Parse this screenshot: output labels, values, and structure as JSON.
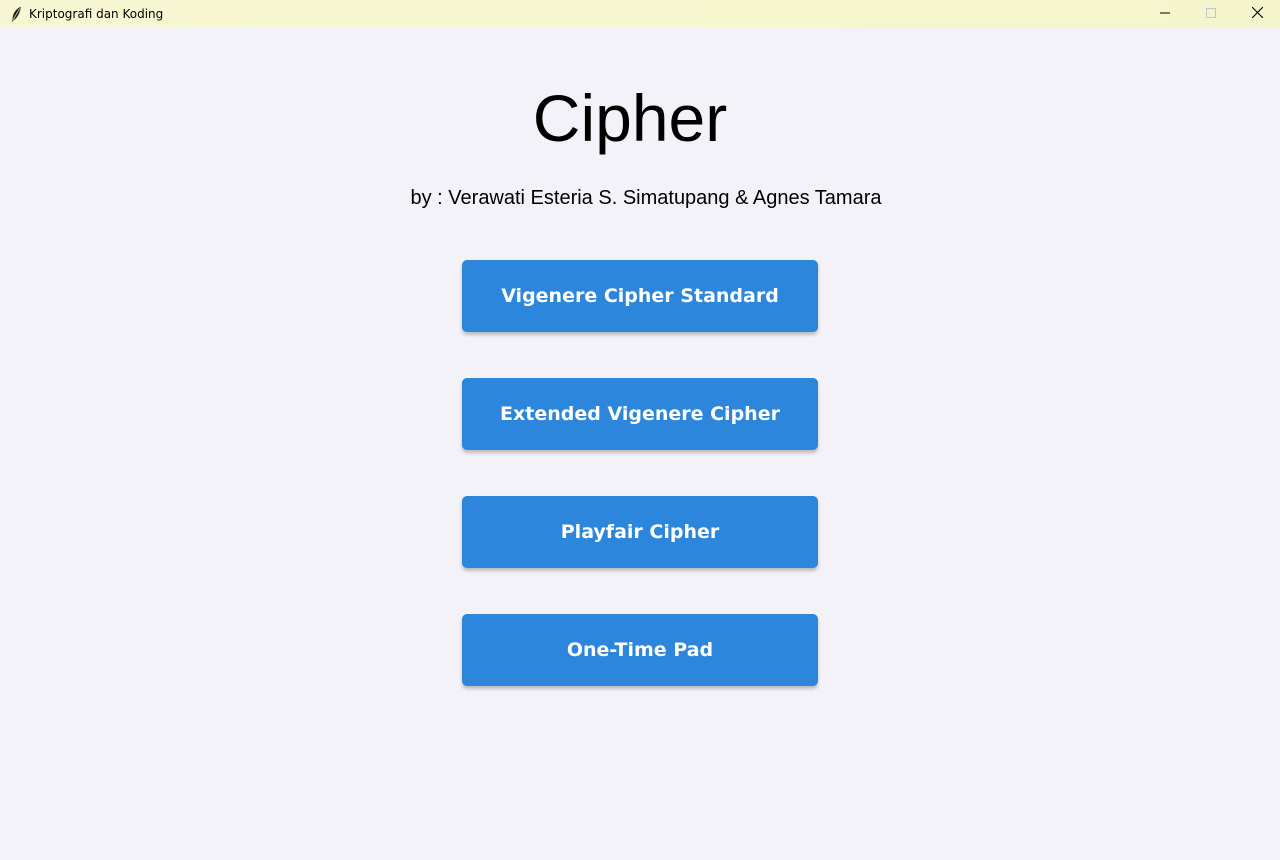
{
  "window": {
    "title": "Kriptografi dan Koding",
    "app_icon": "feather-icon",
    "controls": {
      "minimize_icon": "minimize-icon",
      "maximize_icon": "maximize-icon",
      "close_icon": "close-icon"
    }
  },
  "header": {
    "title": "Cipher",
    "subtitle": "by : Verawati Esteria S. Simatupang & Agnes Tamara"
  },
  "menu": {
    "buttons": [
      {
        "label": "Vigenere Cipher Standard"
      },
      {
        "label": "Extended Vigenere Cipher"
      },
      {
        "label": "Playfair Cipher"
      },
      {
        "label": "One-Time Pad"
      }
    ]
  },
  "colors": {
    "button_background": "#2b86dc",
    "button_text": "#ffffff",
    "page_background": "#f3f2f8",
    "titlebar_background": "#f6f7d0"
  }
}
